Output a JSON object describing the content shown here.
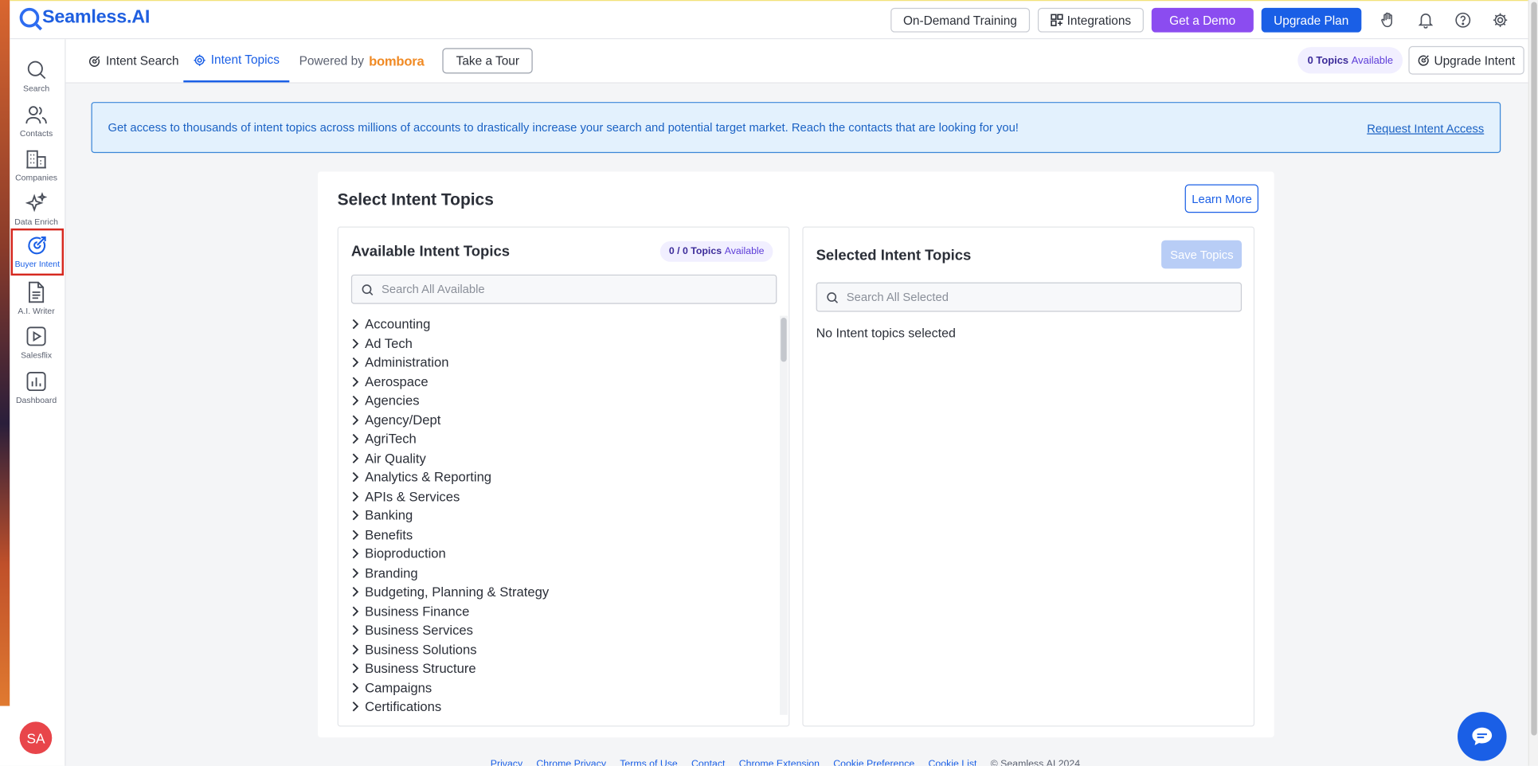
{
  "app": {
    "logo_text": "Seamless.AI"
  },
  "topbar": {
    "training": "On-Demand Training",
    "integrations": "Integrations",
    "demo": "Get a Demo",
    "upgrade": "Upgrade Plan",
    "icons": [
      "hand-icon",
      "bell-icon",
      "help-icon",
      "gear-icon"
    ]
  },
  "sidebar": {
    "items": [
      {
        "label": "Search",
        "icon": "search-icon"
      },
      {
        "label": "Contacts",
        "icon": "contacts-icon"
      },
      {
        "label": "Companies",
        "icon": "companies-icon"
      },
      {
        "label": "Data Enrich",
        "icon": "sparkle-icon"
      },
      {
        "label": "Buyer Intent",
        "icon": "target-icon",
        "active": true
      },
      {
        "label": "A.I. Writer",
        "icon": "document-icon"
      },
      {
        "label": "Salesflix",
        "icon": "play-icon"
      },
      {
        "label": "Dashboard",
        "icon": "chart-icon"
      }
    ],
    "avatar": "SA"
  },
  "subnav": {
    "tab_search": "Intent Search",
    "tab_topics": "Intent Topics",
    "powered_by": "Powered by",
    "bombora": "bombora",
    "tour": "Take a Tour",
    "topics_count": "0 Topics",
    "topics_available": "Available",
    "upgrade_intent": "Upgrade Intent"
  },
  "banner": {
    "text": "Get access to thousands of intent topics across millions of accounts to drastically increase your search and potential target market. Reach the contacts that are looking for you!",
    "link": "Request Intent Access"
  },
  "card": {
    "title": "Select Intent Topics",
    "learn_more": "Learn More",
    "available": {
      "title": "Available Intent Topics",
      "badge_count": "0 / 0 Topics",
      "badge_label": "Available",
      "search_placeholder": "Search All Available",
      "topics": [
        "Accounting",
        "Ad Tech",
        "Administration",
        "Aerospace",
        "Agencies",
        "Agency/Dept",
        "AgriTech",
        "Air Quality",
        "Analytics & Reporting",
        "APIs & Services",
        "Banking",
        "Benefits",
        "Bioproduction",
        "Branding",
        "Budgeting, Planning & Strategy",
        "Business Finance",
        "Business Services",
        "Business Solutions",
        "Business Structure",
        "Campaigns",
        "Certifications"
      ]
    },
    "selected": {
      "title": "Selected Intent Topics",
      "save": "Save Topics",
      "search_placeholder": "Search All Selected",
      "empty": "No Intent topics selected"
    }
  },
  "footer": {
    "links": [
      "Privacy",
      "Chrome Privacy",
      "Terms of Use",
      "Contact",
      "Chrome Extension",
      "Cookie Preference",
      "Cookie List"
    ],
    "copyright": "© Seamless.AI 2024"
  },
  "colors": {
    "brand": "#1a5fe6",
    "demo": "#8b4cf0",
    "badge": "#5d3dd8"
  }
}
